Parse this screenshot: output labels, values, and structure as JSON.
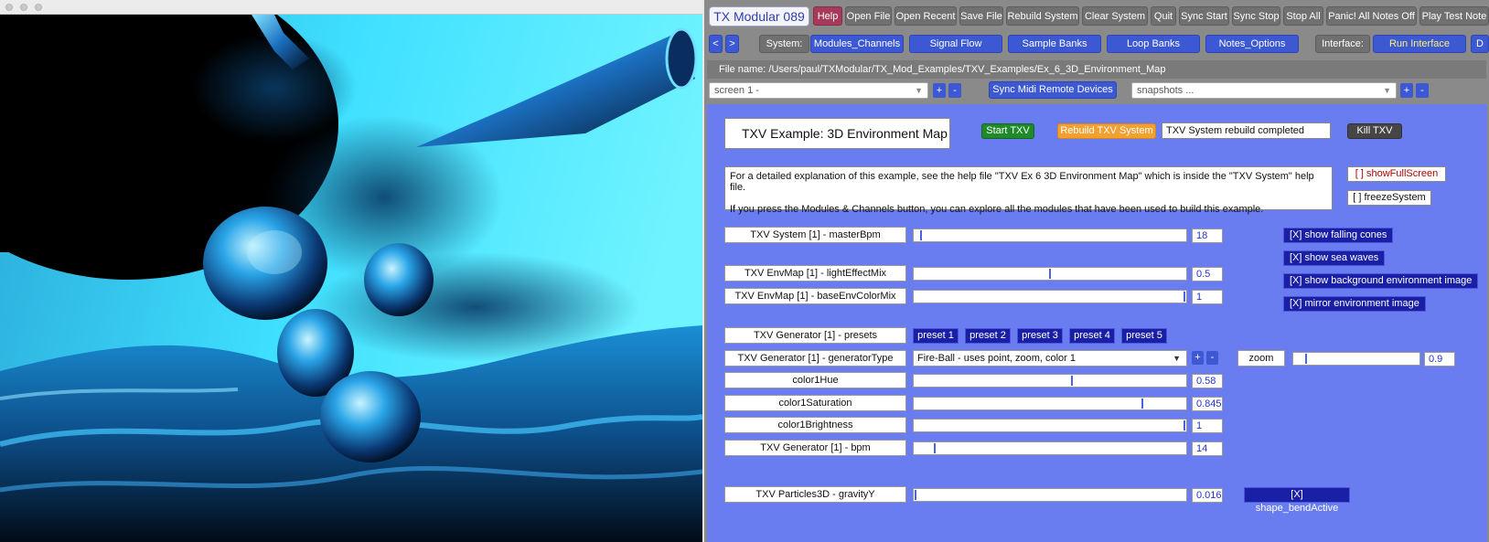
{
  "toolbar": {
    "app_title": "TX Modular 089",
    "buttons": [
      "Help",
      "Open File",
      "Open Recent",
      "Save File",
      "Rebuild System",
      "Clear System",
      "Quit",
      "Sync Start",
      "Sync Stop",
      "Stop All",
      "Panic! All Notes Off",
      "Play Test Note"
    ]
  },
  "nav": {
    "back": "<",
    "forward": ">",
    "system_label": "System:",
    "system_buttons": [
      "Modules_Channels",
      "Signal Flow",
      "Sample Banks",
      "Loop Banks",
      "Notes_Options"
    ],
    "interface_label": "Interface:",
    "run_interface": "Run Interface",
    "extra": "D"
  },
  "file_name": "File name: /Users/paul/TXModular/TX_Mod_Examples/TXV_Examples/Ex_6_3D_Environment_Map",
  "screen_select": "screen 1 -",
  "sync_midi": "Sync Midi Remote Devices",
  "snapshots_select": "snapshots ...",
  "plus": "+",
  "minus": "-",
  "content": {
    "title": "TXV Example: 3D Environment Map",
    "start_txv": "Start TXV",
    "rebuild_txv": "Rebuild TXV System",
    "status": "TXV System rebuild completed",
    "kill_txv": "Kill TXV",
    "desc_1": "For a detailed explanation of this example, see the help file \"TXV Ex 6 3D Environment Map\" which is inside the \"TXV System\" help file.",
    "desc_2": "If you press the Modules & Channels button, you can explore all the modules that have been used to build this example.",
    "show_fullscreen_prefix": "[  ]",
    "show_fullscreen": "showFullScreen",
    "freeze_system": "[  ] freezeSystem",
    "params": [
      {
        "label": "TXV System [1] - masterBpm",
        "value": "18",
        "level": 0.02
      },
      {
        "label": "TXV EnvMap [1] - lightEffectMix",
        "value": "0.5",
        "level": 0.5
      },
      {
        "label": "TXV EnvMap [1] - baseEnvColorMix",
        "value": "1",
        "level": 1.0
      },
      {
        "label": "color1Hue",
        "value": "0.58",
        "level": 0.58
      },
      {
        "label": "color1Saturation",
        "value": "0.845",
        "level": 0.845
      },
      {
        "label": "color1Brightness",
        "value": "1",
        "level": 1.0
      },
      {
        "label": "TXV Generator [1] - bpm",
        "value": "14",
        "level": 0.07
      },
      {
        "label": "TXV Particles3D - gravityY",
        "value": "0.016",
        "level": 0.0
      }
    ],
    "presets_label": "TXV Generator [1] - presets",
    "presets": [
      "preset 1",
      "preset 2",
      "preset 3",
      "preset 4",
      "preset 5"
    ],
    "generator_type_label": "TXV Generator [1] - generatorType",
    "generator_type_value": "Fire-Ball - uses point, zoom, color 1",
    "zoom_label": "zoom",
    "zoom_value": "0.9",
    "zoom_level": 0.09,
    "toggles": [
      "[X] show falling cones",
      "[X] show sea waves",
      "[X] show background environment image",
      "[X] mirror environment image"
    ],
    "shape_bend": "[X] shape_bendActive"
  },
  "colors": {
    "panel_bg": "#8a8a8a",
    "content_bg": "#6a7df0",
    "button_grey": "#707070",
    "button_blue": "#3c59d3",
    "help_button": "#a53a5a",
    "toggle_navy": "#1a20a6",
    "render_cyan": "#3fe3ff"
  }
}
